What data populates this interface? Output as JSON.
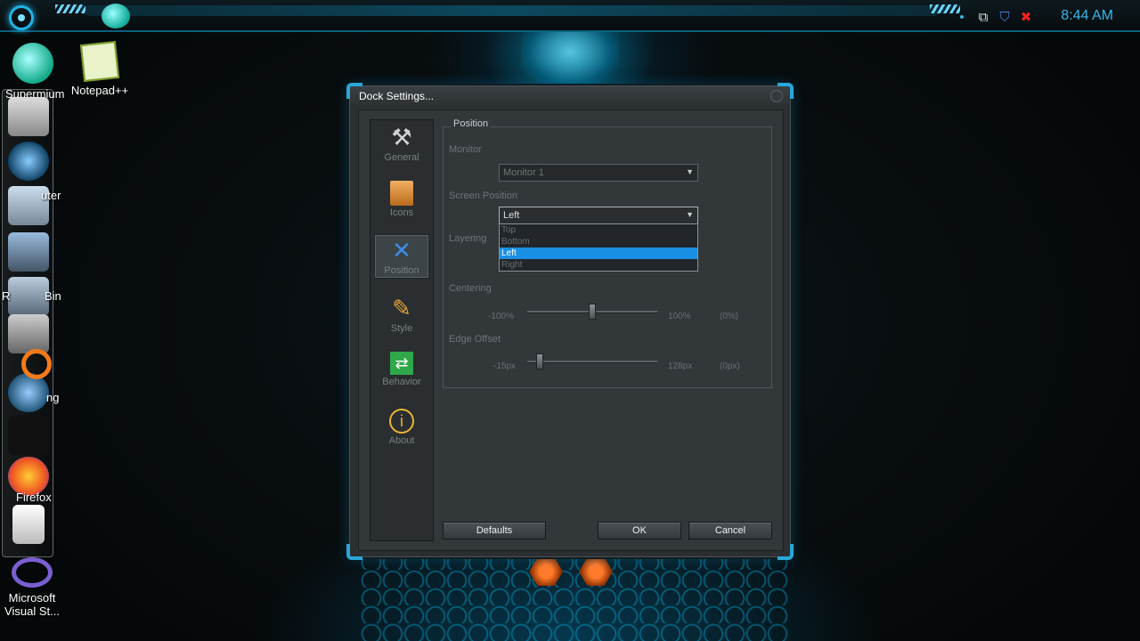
{
  "taskbar": {
    "clock": "8:44 AM",
    "tray_icons": [
      "network-icon",
      "shield-icon",
      "volume-muted-icon"
    ]
  },
  "desktop": {
    "icons": [
      {
        "label": "Supermium"
      },
      {
        "label": "Notepad++"
      }
    ],
    "dock_labels": [
      "uter",
      "R",
      "Bin",
      "ng",
      "Firefox"
    ],
    "bottom_icon": "Microsoft Visual St..."
  },
  "window": {
    "title": "Dock Settings...",
    "nav": [
      {
        "label": "General",
        "icon": "tools-icon"
      },
      {
        "label": "Icons",
        "icon": "box-icon"
      },
      {
        "label": "Position",
        "icon": "position-icon"
      },
      {
        "label": "Style",
        "icon": "pencil-icon"
      },
      {
        "label": "Behavior",
        "icon": "arrows-icon"
      },
      {
        "label": "About",
        "icon": "info-icon"
      }
    ],
    "group_title": "Position",
    "monitor_label": "Monitor",
    "monitor_value": "Monitor 1",
    "screen_position_label": "Screen Position",
    "screen_position_value": "Left",
    "screen_position_options": [
      "Top",
      "Bottom",
      "Left",
      "Right"
    ],
    "layering_label": "Layering",
    "centering_label": "Centering",
    "centering_min": "-100%",
    "centering_max": "100%",
    "centering_value": "(0%)",
    "centering_level": 0.5,
    "edge_offset_label": "Edge Offset",
    "edge_offset_min": "-15px",
    "edge_offset_max": "128px",
    "edge_offset_value": "(0px)",
    "buttons": {
      "defaults": "Defaults",
      "ok": "OK",
      "cancel": "Cancel"
    }
  }
}
